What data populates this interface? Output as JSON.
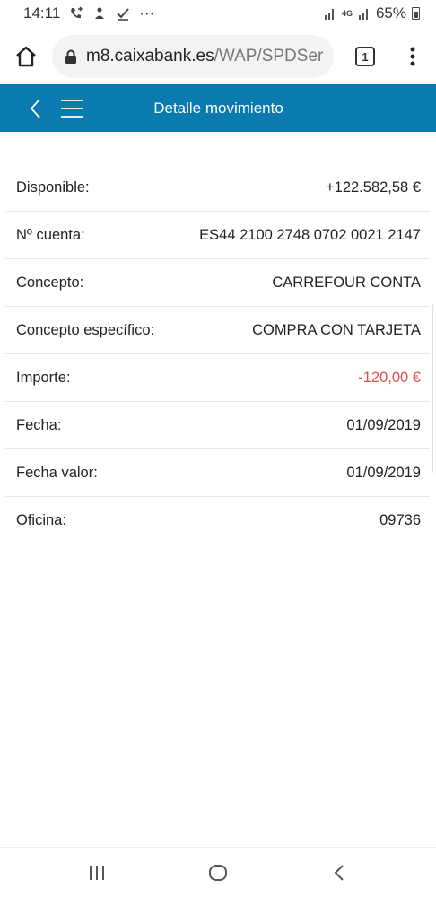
{
  "status_bar": {
    "time": "14:11",
    "battery": "65%",
    "signal_label": "4G",
    "more": "···"
  },
  "browser": {
    "url_domain": "m8.caixabank.es",
    "url_path": "/WAP/SPDSer",
    "tab_count": "1"
  },
  "header": {
    "title": "Detalle movimiento"
  },
  "details": [
    {
      "label": "Disponible:",
      "value": "+122.582,58 €"
    },
    {
      "label": "Nº cuenta:",
      "value": "ES44 2100 2748 0702 0021 2147"
    },
    {
      "label": "Concepto:",
      "value": "CARREFOUR CONTA"
    },
    {
      "label": "Concepto específico:",
      "value": "COMPRA CON TARJETA"
    },
    {
      "label": "Importe:",
      "value": "-120,00 €"
    },
    {
      "label": "Fecha:",
      "value": "01/09/2019"
    },
    {
      "label": "Fecha valor:",
      "value": "01/09/2019"
    },
    {
      "label": "Oficina:",
      "value": "09736"
    }
  ],
  "colors": {
    "header_bg": "#0a7aaf",
    "negative_amount": "#d9534f"
  }
}
